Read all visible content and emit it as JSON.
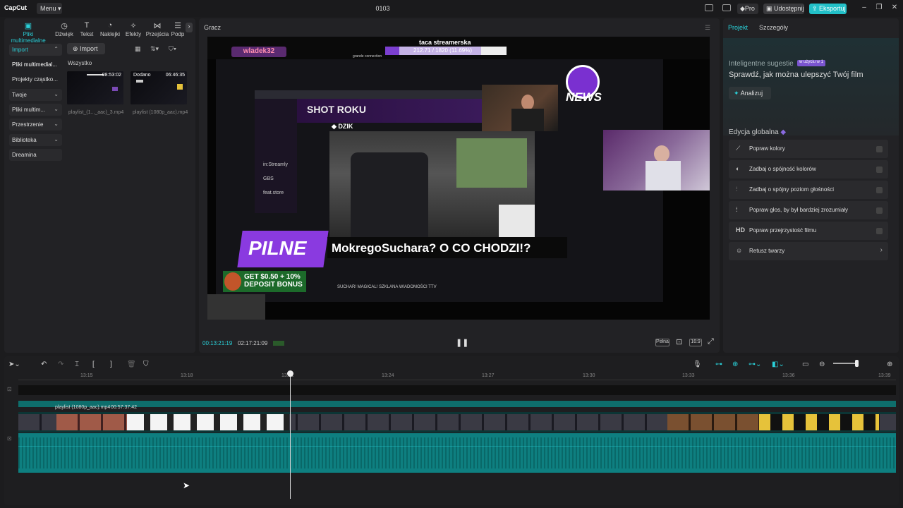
{
  "app": {
    "logo": "CapCut",
    "menu": "Menu",
    "title": "0103",
    "pro": "Pro",
    "share": "Udostępnij",
    "export": "Eksportuj"
  },
  "media_tabs": [
    {
      "label": "Pliki multimedialne",
      "icon": "media-icon"
    },
    {
      "label": "Dźwięk",
      "icon": "audio-icon"
    },
    {
      "label": "Tekst",
      "icon": "text-icon"
    },
    {
      "label": "Naklejki",
      "icon": "sticker-icon"
    },
    {
      "label": "Efekty",
      "icon": "effects-icon"
    },
    {
      "label": "Przejścia",
      "icon": "transition-icon"
    },
    {
      "label": "Podp",
      "icon": "caption-icon"
    }
  ],
  "sidebar": [
    {
      "label": "Import",
      "active": true,
      "chevron": true
    },
    {
      "label": "Pliki multimedial...",
      "active": false,
      "chevron": false
    },
    {
      "label": "Projekty cząstko...",
      "active": false,
      "chevron": false
    },
    {
      "label": "Twoje",
      "active": false,
      "chevron": true
    },
    {
      "label": "Pliki multim...",
      "active": false,
      "chevron": true
    },
    {
      "label": "Przestrzenie",
      "active": false,
      "chevron": true
    },
    {
      "label": "Biblioteka",
      "active": false,
      "chevron": true
    },
    {
      "label": "Dreamina",
      "active": false,
      "chevron": false
    }
  ],
  "media": {
    "import_label": "Import",
    "all_label": "Wszystko",
    "items": [
      {
        "name": "playlist_(1..._aac)_3.mp4",
        "duration": "08:53:02",
        "tag": ""
      },
      {
        "name": "playlist (1080p_aac).mp4",
        "duration": "06:46:35",
        "tag": "Dodano"
      }
    ]
  },
  "player": {
    "title": "Gracz",
    "current_time": "00:13:21:19",
    "total_time": "02:17:21:09",
    "full_label": "Pełna",
    "ratio_label": "16:9",
    "overlay": {
      "streamer_title": "taca streamerska",
      "progress_text": "212.71 / 1820 (11.69%)",
      "channel": "wladek32",
      "shot_title": "SHOT ROKU",
      "pilne": "PILNE",
      "headline": "MokregoSuchara? O CO CHODZI!?",
      "bonus_line1": "GET $0.50 + 10%",
      "bonus_line2": "DEPOSIT BONUS",
      "news": "NEWS",
      "dzik": "DZIK",
      "ticker": "SUCHAR! MAGICAL! SZKLANA WIADOMOŚCI TTV"
    }
  },
  "right_panel": {
    "tabs": [
      "Projekt",
      "Szczegóły"
    ],
    "ai_title": "Inteligentne sugestie",
    "ai_badge": "w użyciu w 1",
    "ai_subtitle": "Sprawdź, jak można ulepszyć Twój film",
    "analyze": "Analizuj",
    "global_title": "Edycja globalna",
    "global_items": [
      {
        "label": "Popraw kolory",
        "icon": "color-icon",
        "type": "toggle"
      },
      {
        "label": "Zadbaj o spójność kolorów",
        "icon": "color-match-icon",
        "type": "toggle"
      },
      {
        "label": "Zadbaj o spójny poziom głośności",
        "icon": "volume-icon",
        "type": "toggle"
      },
      {
        "label": "Popraw głos, by był bardziej zrozumiały",
        "icon": "voice-icon",
        "type": "toggle"
      },
      {
        "label": "Popraw przejrzystość filmu",
        "icon": "hd-icon",
        "type": "toggle"
      },
      {
        "label": "Retusz twarzy",
        "icon": "face-icon",
        "type": "arrow"
      }
    ]
  },
  "timeline": {
    "ruler": [
      "13:15",
      "13:18",
      "13:21",
      "13:24",
      "13:27",
      "13:30",
      "13:33",
      "13:36",
      "13:39"
    ],
    "clip_name": "playlist (1080p_aac).mp4",
    "clip_duration": "00:57:37:42"
  },
  "colors": {
    "accent": "#2ad0d8",
    "export": "#22c0c8",
    "audio": "#0e7f80"
  }
}
